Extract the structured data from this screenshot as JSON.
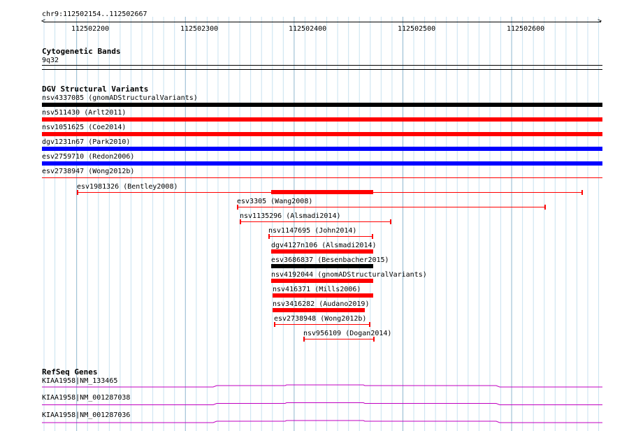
{
  "location": "chr9:112502154..112502667",
  "ruler": {
    "ticks": [
      "112502200",
      "112502300",
      "112502400",
      "112502500",
      "112502600"
    ]
  },
  "cytobands": {
    "title": "Cytogenetic Bands",
    "band": "9q32"
  },
  "dgv": {
    "title": "DGV Structural Variants",
    "full_rows": [
      {
        "label": "nsv4337085 (gnomADStructuralVariants)",
        "color": "#000000"
      },
      {
        "label": "nsv511430 (Arlt2011)",
        "color": "#ff0000"
      },
      {
        "label": "nsv1051625 (Coe2014)",
        "color": "#ff0000"
      },
      {
        "label": "dgv1231n67 (Park2010)",
        "color": "#0000ff"
      },
      {
        "label": "esv2759710 (Redon2006)",
        "color": "#0000ff"
      },
      {
        "label": "esv2738947 (Wong2012b)",
        "color": "#ff0000"
      }
    ],
    "variants": [
      {
        "label": "esv1981326 (Bentley2008)",
        "style": "thin-thick",
        "color": "#ff0000"
      },
      {
        "label": "esv3305 (Wang2008)",
        "style": "thin",
        "color": "#ff0000"
      },
      {
        "label": "nsv1135296 (Alsmadi2014)",
        "style": "thin",
        "color": "#ff0000"
      },
      {
        "label": "nsv1147695 (John2014)",
        "style": "thin",
        "color": "#ff0000"
      },
      {
        "label": "dgv4127n106 (Alsmadi2014)",
        "style": "thick",
        "color": "#ff0000"
      },
      {
        "label": "esv3686837 (Besenbacher2015)",
        "style": "thick",
        "color": "#000000"
      },
      {
        "label": "nsv4192044 (gnomADStructuralVariants)",
        "style": "thick",
        "color": "#ff0000"
      },
      {
        "label": "nsv416371 (Mills2006)",
        "style": "thick",
        "color": "#ff0000"
      },
      {
        "label": "nsv3416282 (Audano2019)",
        "style": "thick",
        "color": "#ff0000"
      },
      {
        "label": "esv2738948 (Wong2012b)",
        "style": "thin",
        "color": "#ff0000"
      },
      {
        "label": "nsv956109 (Dogan2014)",
        "style": "thin",
        "color": "#ff0000"
      }
    ]
  },
  "refseq": {
    "title": "RefSeq Genes",
    "genes": [
      {
        "label": "KIAA1958|NM_133465",
        "color": "#c000c0"
      },
      {
        "label": "KIAA1958|NM_001287038",
        "color": "#c000c0"
      },
      {
        "label": "KIAA1958|NM_001287036",
        "color": "#c000c0"
      }
    ]
  }
}
